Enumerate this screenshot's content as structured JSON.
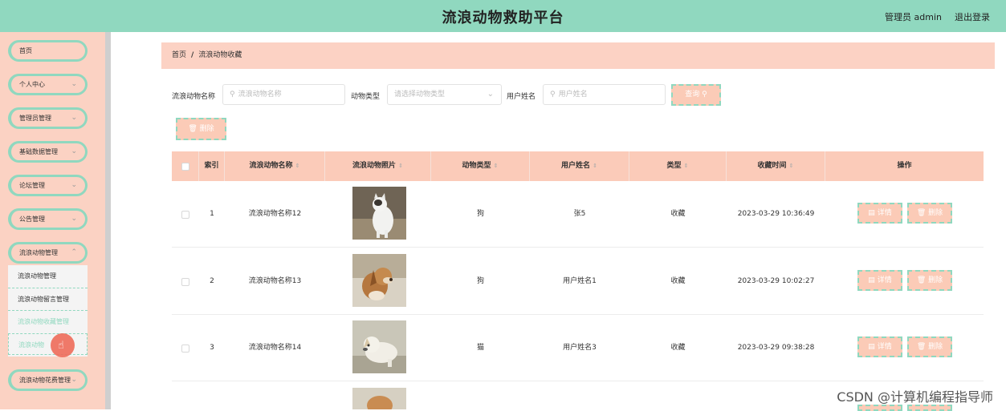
{
  "header": {
    "title": "流浪动物救助平台",
    "user": "管理员 admin",
    "logout": "退出登录"
  },
  "sidebar": {
    "items": [
      {
        "label": "首页"
      },
      {
        "label": "个人中心"
      },
      {
        "label": "管理员管理"
      },
      {
        "label": "基础数据管理"
      },
      {
        "label": "论坛管理"
      },
      {
        "label": "公告管理"
      },
      {
        "label": "流浪动物管理"
      },
      {
        "label": "流浪动物花费管理"
      }
    ],
    "submenu": [
      {
        "label": "流浪动物管理"
      },
      {
        "label": "流浪动物留言管理"
      },
      {
        "label": "流浪动物收藏管理"
      },
      {
        "label": "流浪动物"
      }
    ]
  },
  "breadcrumb": {
    "home": "首页",
    "sep": "/",
    "current": "流浪动物收藏"
  },
  "filters": {
    "name_label": "流浪动物名称",
    "name_placeholder": "流浪动物名称",
    "type_label": "动物类型",
    "type_placeholder": "请选择动物类型",
    "user_label": "用户姓名",
    "user_placeholder": "用户姓名",
    "search_button": "查询"
  },
  "toolbar": {
    "delete_button": "删除"
  },
  "table": {
    "headers": [
      "索引",
      "流浪动物名称",
      "流浪动物照片",
      "动物类型",
      "用户姓名",
      "类型",
      "收藏时间",
      "操作"
    ],
    "rows": [
      {
        "index": "1",
        "name": "流浪动物名称12",
        "animal_type": "狗",
        "user": "张5",
        "kind": "收藏",
        "time": "2023-03-29 10:36:49"
      },
      {
        "index": "2",
        "name": "流浪动物名称13",
        "animal_type": "狗",
        "user": "用户姓名1",
        "kind": "收藏",
        "time": "2023-03-29 10:02:27"
      },
      {
        "index": "3",
        "name": "流浪动物名称14",
        "animal_type": "猫",
        "user": "用户姓名3",
        "kind": "收藏",
        "time": "2023-03-29 09:38:28"
      }
    ],
    "actions": {
      "detail": "详情",
      "delete": "删除"
    }
  },
  "watermark": "CSDN @计算机编程指导师"
}
